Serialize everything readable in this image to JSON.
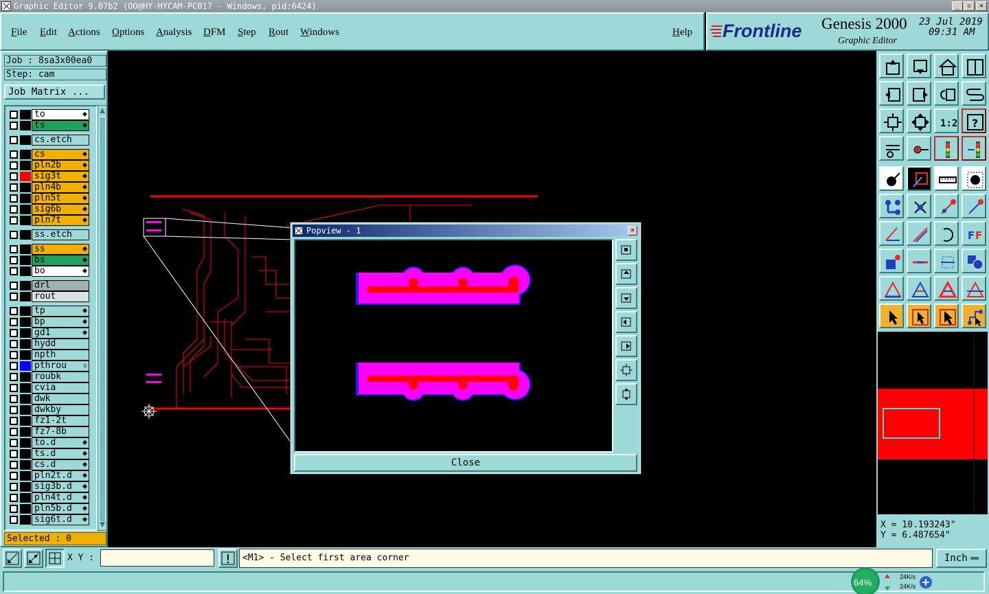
{
  "window": {
    "title": "Graphic Editor 9.07b2 (OO@HY-HYCAM-PC017 - Windows, pid:6424)",
    "minimize": "_",
    "maximize": "▫",
    "close": "✕"
  },
  "menu": {
    "items": [
      "File",
      "Edit",
      "Actions",
      "Options",
      "Analysis",
      "DFM",
      "Step",
      "Rout",
      "Windows"
    ],
    "help": "Help"
  },
  "brand": {
    "logo": "Frontline",
    "product": "Genesis 2000",
    "subtitle": "Graphic Editor",
    "date": "23 Jul 2019",
    "time": "09:31 AM"
  },
  "job": {
    "job_label": "Job : 8sa3x00ea0",
    "step_label": "Step: cam",
    "matrix_button": "Job Matrix ..."
  },
  "layers": [
    {
      "name": "to",
      "color": "#ffffff",
      "flag": "⬥",
      "mark": ""
    },
    {
      "name": "ts",
      "color": "#20a060",
      "flag": "⬥",
      "mark": ""
    },
    {
      "name": "cs.etch",
      "color": "#9ed9d9",
      "flag": "",
      "mark": ""
    },
    {
      "name": "cs",
      "color": "#f0b000",
      "flag": "⬥",
      "mark": ""
    },
    {
      "name": "pln2b",
      "color": "#f0b000",
      "flag": "⬥",
      "mark": ""
    },
    {
      "name": "sig3t",
      "color": "#f0b000",
      "flag": "⬥",
      "mark": "#ff0000"
    },
    {
      "name": "pln4b",
      "color": "#f0b000",
      "flag": "⬥",
      "mark": ""
    },
    {
      "name": "pln5t",
      "color": "#f0b000",
      "flag": "⬥",
      "mark": ""
    },
    {
      "name": "sig6b",
      "color": "#f0b000",
      "flag": "⬥",
      "mark": ""
    },
    {
      "name": "pln7t",
      "color": "#f0b000",
      "flag": "⬥",
      "mark": ""
    },
    {
      "name": "ss.etch",
      "color": "#9ed9d9",
      "flag": "",
      "mark": ""
    },
    {
      "name": "ss",
      "color": "#f0b000",
      "flag": "⬥",
      "mark": ""
    },
    {
      "name": "bs",
      "color": "#20a060",
      "flag": "⬥",
      "mark": ""
    },
    {
      "name": "bo",
      "color": "#ffffff",
      "flag": "⬥",
      "mark": ""
    },
    {
      "name": "drl",
      "color": "#a0b0b0",
      "flag": "",
      "mark": ""
    },
    {
      "name": "rout",
      "color": "#d8e0e0",
      "flag": "",
      "mark": ""
    },
    {
      "name": "tp",
      "color": "#9ed9d9",
      "flag": "⬥",
      "mark": ""
    },
    {
      "name": "bp",
      "color": "#9ed9d9",
      "flag": "⬥",
      "mark": ""
    },
    {
      "name": "gd1",
      "color": "#9ed9d9",
      "flag": "⬥",
      "mark": ""
    },
    {
      "name": "hydd",
      "color": "#9ed9d9",
      "flag": "",
      "mark": ""
    },
    {
      "name": "npth",
      "color": "#9ed9d9",
      "flag": "",
      "mark": ""
    },
    {
      "name": "pthrou",
      "color": "#9ed9d9",
      "flag": "▫",
      "mark": "#0000ff"
    },
    {
      "name": "roubk",
      "color": "#9ed9d9",
      "flag": "",
      "mark": ""
    },
    {
      "name": "cvia",
      "color": "#9ed9d9",
      "flag": "",
      "mark": ""
    },
    {
      "name": "dwk",
      "color": "#9ed9d9",
      "flag": "",
      "mark": ""
    },
    {
      "name": "dwkby",
      "color": "#9ed9d9",
      "flag": "",
      "mark": ""
    },
    {
      "name": "fz1-2t",
      "color": "#9ed9d9",
      "flag": "",
      "mark": ""
    },
    {
      "name": "fz7-8b",
      "color": "#9ed9d9",
      "flag": "",
      "mark": ""
    },
    {
      "name": "to.d",
      "color": "#9ed9d9",
      "flag": "⬥",
      "mark": ""
    },
    {
      "name": "ts.d",
      "color": "#9ed9d9",
      "flag": "⬥",
      "mark": ""
    },
    {
      "name": "cs.d",
      "color": "#9ed9d9",
      "flag": "⬥",
      "mark": ""
    },
    {
      "name": "pln2t.d",
      "color": "#9ed9d9",
      "flag": "⬥",
      "mark": ""
    },
    {
      "name": "sig3b.d",
      "color": "#9ed9d9",
      "flag": "⬥",
      "mark": ""
    },
    {
      "name": "pln4t.d",
      "color": "#9ed9d9",
      "flag": "⬥",
      "mark": ""
    },
    {
      "name": "pln5b.d",
      "color": "#9ed9d9",
      "flag": "⬥",
      "mark": ""
    },
    {
      "name": "sig6t.d",
      "color": "#9ed9d9",
      "flag": "⬥",
      "mark": ""
    }
  ],
  "selected_label": "Selected : 0",
  "popview": {
    "title": "Popview - 1",
    "close_button": "Close"
  },
  "coords": {
    "x": "X = 10.193243\"",
    "y": "Y = 6.487654\""
  },
  "command": {
    "xy_label": "X Y :",
    "xy_value": "",
    "message": "<M1> - Select first area corner",
    "unit": "Inch"
  },
  "network": {
    "percent": "64%",
    "upload": "24K/s",
    "download": "24K/s"
  },
  "colors": {
    "panel": "#9ed9d9",
    "trace": "#ff0000",
    "pad": "#ff00ff",
    "pad_edge": "#2020ff"
  }
}
